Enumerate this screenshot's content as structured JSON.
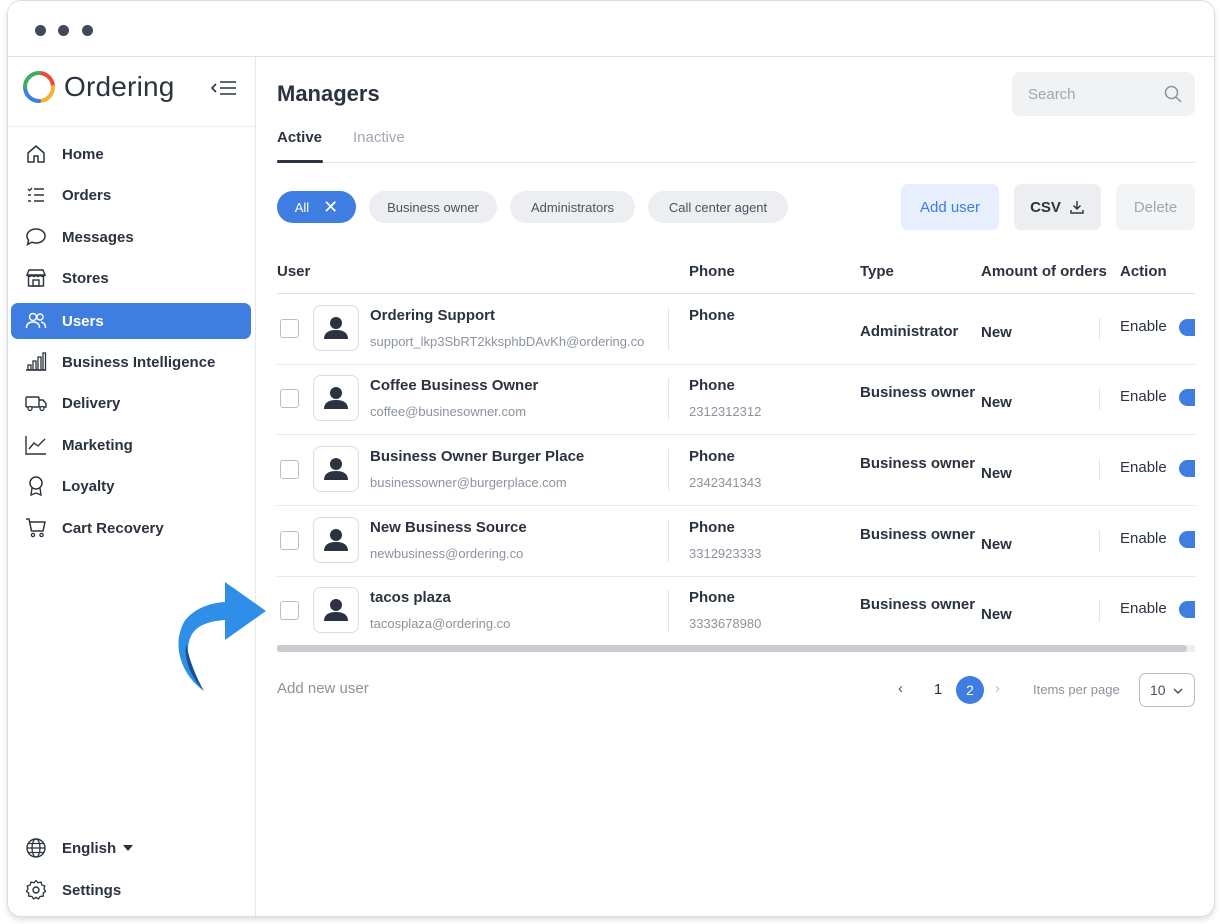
{
  "brand": {
    "name": "Ordering"
  },
  "sidebar": {
    "items": [
      {
        "label": "Home",
        "icon": "home-icon"
      },
      {
        "label": "Orders",
        "icon": "orders-list-icon"
      },
      {
        "label": "Messages",
        "icon": "chat-bubble-icon"
      },
      {
        "label": "Stores",
        "icon": "store-icon"
      },
      {
        "label": "Users",
        "icon": "users-icon",
        "active": true
      },
      {
        "label": "Business Intelligence",
        "icon": "bar-chart-icon"
      },
      {
        "label": "Delivery",
        "icon": "truck-icon"
      },
      {
        "label": "Marketing",
        "icon": "line-chart-icon"
      },
      {
        "label": "Loyalty",
        "icon": "award-icon"
      },
      {
        "label": "Cart Recovery",
        "icon": "cart-icon"
      }
    ],
    "footer": {
      "language": "English",
      "settings": "Settings"
    }
  },
  "main": {
    "title": "Managers",
    "search": {
      "placeholder": "Search"
    },
    "tabs": [
      {
        "label": "Active",
        "active": true
      },
      {
        "label": "Inactive",
        "active": false
      }
    ],
    "filters": [
      "All",
      "Business owner",
      "Administrators",
      "Call center agent"
    ],
    "buttons": {
      "add_user": "Add user",
      "csv": "CSV",
      "delete": "Delete"
    },
    "table": {
      "headers": [
        "User",
        "Phone",
        "Type",
        "Amount of orders",
        "Action"
      ],
      "rows": [
        {
          "name": "Ordering Support",
          "email": "support_lkp3SbRT2kksphbDAvKh@ordering.co",
          "phone_label": "Phone",
          "phone": "",
          "type": "Administrator",
          "orders": "New",
          "action": "Enable"
        },
        {
          "name": "Coffee Business Owner",
          "email": "coffee@businesowner.com",
          "phone_label": "Phone",
          "phone": "2312312312",
          "type": "Business owner",
          "orders": "New",
          "action": "Enable"
        },
        {
          "name": "Business Owner Burger Place",
          "email": "businessowner@burgerplace.com",
          "phone_label": "Phone",
          "phone": "2342341343",
          "type": "Business owner",
          "orders": "New",
          "action": "Enable"
        },
        {
          "name": "New Business Source",
          "email": "newbusiness@ordering.co",
          "phone_label": "Phone",
          "phone": "3312923333",
          "type": "Business owner",
          "orders": "New",
          "action": "Enable"
        },
        {
          "name": "tacos plaza",
          "email": "tacosplaza@ordering.co",
          "phone_label": "Phone",
          "phone": "3333678980",
          "type": "Business owner",
          "orders": "New",
          "action": "Enable"
        }
      ]
    },
    "add_new_user": "Add new user",
    "pagination": {
      "prev": "‹",
      "pages": [
        "1",
        "2"
      ],
      "current": "2",
      "next": "›",
      "items_per_page_label": "Items per page",
      "items_per_page": "10"
    }
  },
  "colors": {
    "accent": "#3f7de0",
    "text": "#2b3340",
    "muted": "#8b939e",
    "arrow": "#2f8fe8"
  }
}
